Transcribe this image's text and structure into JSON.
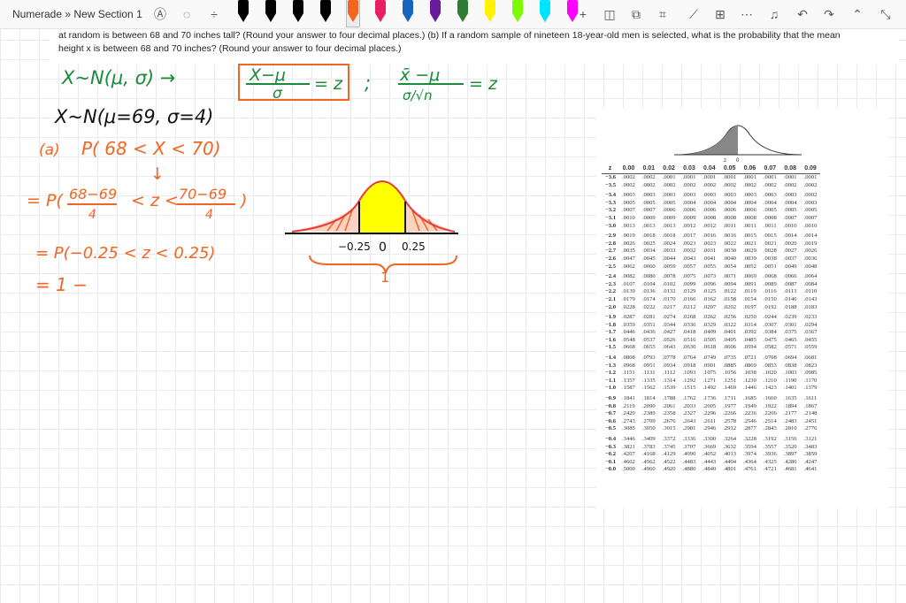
{
  "toolbar": {
    "breadcrumb": "Numerade » New Section 1",
    "pens": [
      "#000000",
      "#000000",
      "#000000",
      "#000000",
      "#f26522",
      "#e91e63",
      "#1565c0",
      "#6a1b9a",
      "#2e7d32",
      "#fff200",
      "#7cfc00",
      "#00e5ff",
      "#ff00ff",
      "#00a651"
    ],
    "selected_pen": 4
  },
  "problem": {
    "line1": "at random is between 68 and 70 inches tall? (Round your answer to four decimal places.) (b) If a random sample of nineteen 18-year-old men is selected, what is the probability that the mean",
    "line2": "height x is between 68 and 70 inches? (Round your answer to four decimal places.)"
  },
  "handwriting": {
    "formula1_lhs": "X~N(μ, σ) →",
    "formula1_frac_num": "X−μ",
    "formula1_frac_den": "σ",
    "formula1_rhs": "= z",
    "semicolon": ";",
    "formula2_frac_num": "x̄ −μ",
    "formula2_frac_den": "σ/√n",
    "formula2_rhs": "= z",
    "line2": "X~N(μ=69, σ=4)",
    "part_a": "(a)",
    "part_a_expr": "P( 68 < X < 70)",
    "arrow": "↓",
    "step1_prefix": "= P(",
    "step1_frac1_num": "68−69",
    "step1_frac1_den": "4",
    "step1_mid": "< z <",
    "step1_frac2_num": "70−69",
    "step1_frac2_den": "4",
    "step1_close": ")",
    "step2": "= P(−0.25 < z < 0.25)",
    "step3": "= 1 −",
    "curve_label_left": "−0.25",
    "curve_label_zero": "0",
    "curve_label_right": "0.25",
    "brace_label": "1"
  },
  "ztable": {
    "curve_z_label": "z",
    "curve_zero_label": "0",
    "headers": [
      "z",
      "0.00",
      "0.01",
      "0.02",
      "0.03",
      "0.04",
      "0.05",
      "0.06",
      "0.07",
      "0.08",
      "0.09"
    ],
    "groups": [
      [
        [
          "−3.6",
          ".0002",
          ".0002",
          ".0001",
          ".0001",
          ".0001",
          ".0001",
          ".0001",
          ".0001",
          ".0001",
          ".0001"
        ],
        [
          "−3.5",
          ".0002",
          ".0002",
          ".0002",
          ".0002",
          ".0002",
          ".0002",
          ".0002",
          ".0002",
          ".0002",
          ".0002"
        ]
      ],
      [
        [
          "−3.4",
          ".0003",
          ".0003",
          ".0003",
          ".0003",
          ".0003",
          ".0003",
          ".0003",
          ".0003",
          ".0003",
          ".0002"
        ],
        [
          "−3.3",
          ".0005",
          ".0005",
          ".0005",
          ".0004",
          ".0004",
          ".0004",
          ".0004",
          ".0004",
          ".0004",
          ".0003"
        ],
        [
          "−3.2",
          ".0007",
          ".0007",
          ".0006",
          ".0006",
          ".0006",
          ".0006",
          ".0006",
          ".0005",
          ".0005",
          ".0005"
        ],
        [
          "−3.1",
          ".0010",
          ".0009",
          ".0009",
          ".0009",
          ".0008",
          ".0008",
          ".0008",
          ".0008",
          ".0007",
          ".0007"
        ],
        [
          "−3.0",
          ".0013",
          ".0013",
          ".0013",
          ".0012",
          ".0012",
          ".0011",
          ".0011",
          ".0011",
          ".0010",
          ".0010"
        ]
      ],
      [
        [
          "−2.9",
          ".0019",
          ".0018",
          ".0018",
          ".0017",
          ".0016",
          ".0016",
          ".0015",
          ".0015",
          ".0014",
          ".0014"
        ],
        [
          "−2.8",
          ".0026",
          ".0025",
          ".0024",
          ".0023",
          ".0023",
          ".0022",
          ".0021",
          ".0021",
          ".0020",
          ".0019"
        ],
        [
          "−2.7",
          ".0035",
          ".0034",
          ".0033",
          ".0032",
          ".0031",
          ".0030",
          ".0029",
          ".0028",
          ".0027",
          ".0026"
        ],
        [
          "−2.6",
          ".0047",
          ".0045",
          ".0044",
          ".0043",
          ".0041",
          ".0040",
          ".0039",
          ".0038",
          ".0037",
          ".0036"
        ],
        [
          "−2.5",
          ".0062",
          ".0060",
          ".0059",
          ".0057",
          ".0055",
          ".0054",
          ".0052",
          ".0051",
          ".0049",
          ".0048"
        ]
      ],
      [
        [
          "−2.4",
          ".0082",
          ".0080",
          ".0078",
          ".0075",
          ".0073",
          ".0071",
          ".0069",
          ".0068",
          ".0066",
          ".0064"
        ],
        [
          "−2.3",
          ".0107",
          ".0104",
          ".0102",
          ".0099",
          ".0096",
          ".0094",
          ".0091",
          ".0089",
          ".0087",
          ".0084"
        ],
        [
          "−2.2",
          ".0139",
          ".0136",
          ".0132",
          ".0129",
          ".0125",
          ".0122",
          ".0119",
          ".0116",
          ".0113",
          ".0110"
        ],
        [
          "−2.1",
          ".0179",
          ".0174",
          ".0170",
          ".0166",
          ".0162",
          ".0158",
          ".0154",
          ".0150",
          ".0146",
          ".0143"
        ],
        [
          "−2.0",
          ".0228",
          ".0222",
          ".0217",
          ".0212",
          ".0207",
          ".0202",
          ".0197",
          ".0192",
          ".0188",
          ".0183"
        ]
      ],
      [
        [
          "−1.9",
          ".0287",
          ".0281",
          ".0274",
          ".0268",
          ".0262",
          ".0256",
          ".0250",
          ".0244",
          ".0239",
          ".0233"
        ],
        [
          "−1.8",
          ".0359",
          ".0351",
          ".0344",
          ".0336",
          ".0329",
          ".0322",
          ".0314",
          ".0307",
          ".0301",
          ".0294"
        ],
        [
          "−1.7",
          ".0446",
          ".0436",
          ".0427",
          ".0418",
          ".0409",
          ".0401",
          ".0392",
          ".0384",
          ".0375",
          ".0367"
        ],
        [
          "−1.6",
          ".0548",
          ".0537",
          ".0526",
          ".0516",
          ".0505",
          ".0495",
          ".0485",
          ".0475",
          ".0465",
          ".0455"
        ],
        [
          "−1.5",
          ".0668",
          ".0655",
          ".0643",
          ".0630",
          ".0618",
          ".0606",
          ".0594",
          ".0582",
          ".0571",
          ".0559"
        ]
      ],
      [
        [
          "−1.4",
          ".0808",
          ".0793",
          ".0778",
          ".0764",
          ".0749",
          ".0735",
          ".0721",
          ".0708",
          ".0694",
          ".0681"
        ],
        [
          "−1.3",
          ".0968",
          ".0951",
          ".0934",
          ".0918",
          ".0901",
          ".0885",
          ".0869",
          ".0853",
          ".0838",
          ".0823"
        ],
        [
          "−1.2",
          ".1151",
          ".1131",
          ".1112",
          ".1093",
          ".1075",
          ".1056",
          ".1038",
          ".1020",
          ".1003",
          ".0985"
        ],
        [
          "−1.1",
          ".1357",
          ".1335",
          ".1314",
          ".1292",
          ".1271",
          ".1251",
          ".1230",
          ".1210",
          ".1190",
          ".1170"
        ],
        [
          "−1.0",
          ".1587",
          ".1562",
          ".1539",
          ".1515",
          ".1492",
          ".1469",
          ".1446",
          ".1423",
          ".1401",
          ".1379"
        ]
      ],
      [
        [
          "−0.9",
          ".1841",
          ".1814",
          ".1788",
          ".1762",
          ".1736",
          ".1711",
          ".1685",
          ".1660",
          ".1635",
          ".1611"
        ],
        [
          "−0.8",
          ".2119",
          ".2090",
          ".2061",
          ".2033",
          ".2005",
          ".1977",
          ".1949",
          ".1922",
          ".1894",
          ".1867"
        ],
        [
          "−0.7",
          ".2420",
          ".2389",
          ".2358",
          ".2327",
          ".2296",
          ".2266",
          ".2236",
          ".2206",
          ".2177",
          ".2148"
        ],
        [
          "−0.6",
          ".2743",
          ".2709",
          ".2676",
          ".2643",
          ".2611",
          ".2578",
          ".2546",
          ".2514",
          ".2483",
          ".2451"
        ],
        [
          "−0.5",
          ".3085",
          ".3050",
          ".3015",
          ".2981",
          ".2946",
          ".2912",
          ".2877",
          ".2843",
          ".2810",
          ".2776"
        ]
      ],
      [
        [
          "−0.4",
          ".3446",
          ".3409",
          ".3372",
          ".3336",
          ".3300",
          ".3264",
          ".3228",
          ".3192",
          ".3156",
          ".3121"
        ],
        [
          "−0.3",
          ".3821",
          ".3783",
          ".3745",
          ".3707",
          ".3669",
          ".3632",
          ".3594",
          ".3557",
          ".3520",
          ".3483"
        ],
        [
          "−0.2",
          ".4207",
          ".4168",
          ".4129",
          ".4090",
          ".4052",
          ".4013",
          ".3974",
          ".3936",
          ".3897",
          ".3859"
        ],
        [
          "−0.1",
          ".4602",
          ".4562",
          ".4522",
          ".4483",
          ".4443",
          ".4404",
          ".4364",
          ".4325",
          ".4286",
          ".4247"
        ],
        [
          "−0.0",
          ".5000",
          ".4960",
          ".4920",
          ".4880",
          ".4840",
          ".4801",
          ".4761",
          ".4721",
          ".4681",
          ".4641"
        ]
      ]
    ]
  }
}
